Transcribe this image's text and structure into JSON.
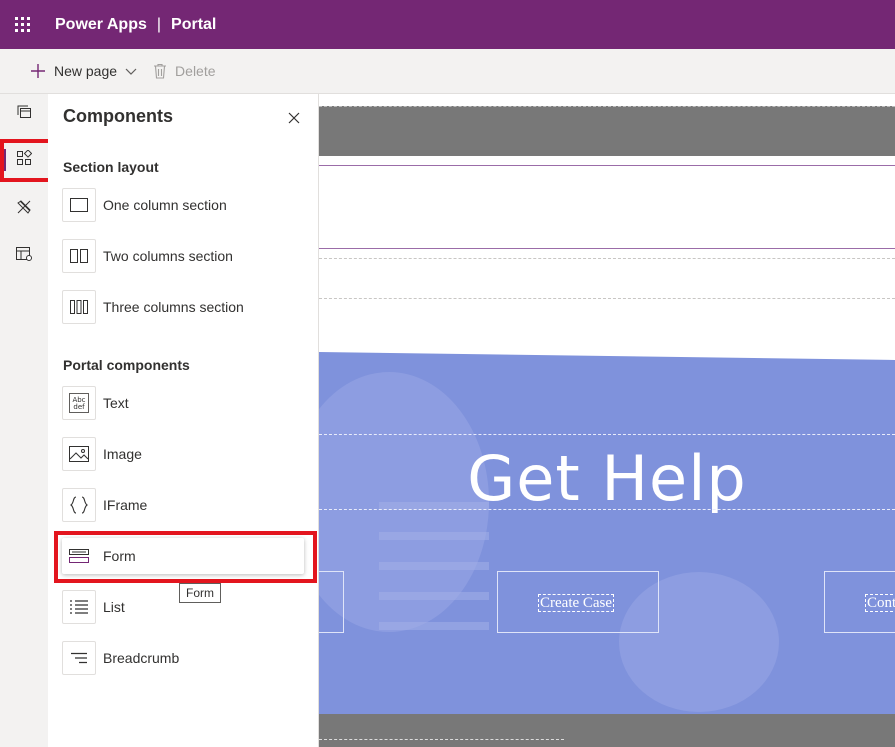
{
  "header": {
    "app_name": "Power Apps",
    "separator": "|",
    "site_name": "Portal"
  },
  "commandbar": {
    "new_page_label": "New page",
    "delete_label": "Delete"
  },
  "rail": {
    "items": [
      {
        "icon": "pages-icon"
      },
      {
        "icon": "components-icon",
        "active": true
      },
      {
        "icon": "themes-icon"
      },
      {
        "icon": "templates-icon"
      }
    ]
  },
  "panel": {
    "title": "Components",
    "section_layout_heading": "Section layout",
    "section_layouts": [
      {
        "label": "One column section",
        "icon": "one-column-icon"
      },
      {
        "label": "Two columns section",
        "icon": "two-columns-icon"
      },
      {
        "label": "Three columns section",
        "icon": "three-columns-icon"
      }
    ],
    "portal_components_heading": "Portal components",
    "portal_components": [
      {
        "label": "Text",
        "icon": "text-icon"
      },
      {
        "label": "Image",
        "icon": "image-icon"
      },
      {
        "label": "IFrame",
        "icon": "iframe-icon"
      },
      {
        "label": "Form",
        "icon": "form-icon",
        "hovered": true
      },
      {
        "label": "List",
        "icon": "list-icon"
      },
      {
        "label": "Breadcrumb",
        "icon": "breadcrumb-icon"
      }
    ],
    "tooltip": "Form"
  },
  "canvas": {
    "hero_title": "Get Help",
    "hero_buttons": [
      "Create Case",
      "Cont"
    ]
  },
  "colors": {
    "brand": "#742774",
    "highlight": "#e3151e",
    "hero": "#7f92dc"
  }
}
